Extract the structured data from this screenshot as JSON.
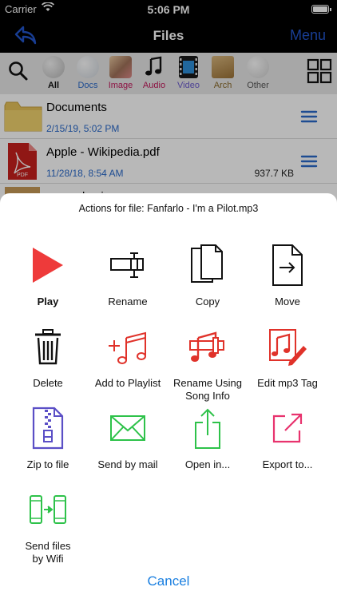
{
  "status": {
    "carrier": "Carrier",
    "time": "5:06 PM"
  },
  "navbar": {
    "title": "Files",
    "menu_label": "Menu"
  },
  "filters": [
    {
      "label": "All",
      "color": "#111111",
      "icon": "all-disc-icon"
    },
    {
      "label": "Docs",
      "color": "#2a6acb",
      "icon": "docs-disc-icon"
    },
    {
      "label": "Image",
      "color": "#c2185b",
      "icon": "image-icon"
    },
    {
      "label": "Audio",
      "color": "#c2185b",
      "icon": "music-note-icon"
    },
    {
      "label": "Video",
      "color": "#6a5acd",
      "icon": "film-icon"
    },
    {
      "label": "Arch",
      "color": "#8a6a2a",
      "icon": "archive-box-icon"
    },
    {
      "label": "Other",
      "color": "#555555",
      "icon": "other-disc-icon"
    }
  ],
  "files": [
    {
      "name": "Documents",
      "date": "2/15/19, 5:02 PM",
      "size": "",
      "icon": "folder-icon"
    },
    {
      "name": "Apple - Wikipedia.pdf",
      "date": "11/28/18, 8:54 AM",
      "size": "937.7 KB",
      "icon": "pdf-icon"
    },
    {
      "name": "example.zip",
      "date": "",
      "size": "",
      "icon": "zip-box-icon"
    }
  ],
  "sheet": {
    "title": "Actions for file: Fanfarlo - I'm a Pilot.mp3",
    "cancel_label": "Cancel",
    "actions": [
      {
        "label": "Play",
        "icon": "play-icon"
      },
      {
        "label": "Rename",
        "icon": "rename-cursor-icon"
      },
      {
        "label": "Copy",
        "icon": "copy-docs-icon"
      },
      {
        "label": "Move",
        "icon": "move-doc-icon"
      },
      {
        "label": "Delete",
        "icon": "trash-icon"
      },
      {
        "label": "Add to Playlist",
        "icon": "add-to-playlist-icon"
      },
      {
        "label": "Rename Using Song Info",
        "icon": "rename-song-info-icon"
      },
      {
        "label": "Edit mp3 Tag",
        "icon": "edit-mp3-tag-icon"
      },
      {
        "label": "Zip to file",
        "icon": "zip-file-icon"
      },
      {
        "label": "Send by mail",
        "icon": "mail-icon"
      },
      {
        "label": "Open in...",
        "icon": "share-icon"
      },
      {
        "label": "Export to...",
        "icon": "export-icon"
      },
      {
        "label": "Send files by Wifi",
        "icon": "wifi-transfer-icon"
      }
    ]
  },
  "colors": {
    "accent": "#1a7fe0",
    "nav_blue": "#2255cc",
    "play_red": "#ee3a3a",
    "music_red": "#e0322a",
    "zip_purple": "#5b4fc6",
    "mail_green": "#2ec24a",
    "export_pink": "#e8336e"
  }
}
